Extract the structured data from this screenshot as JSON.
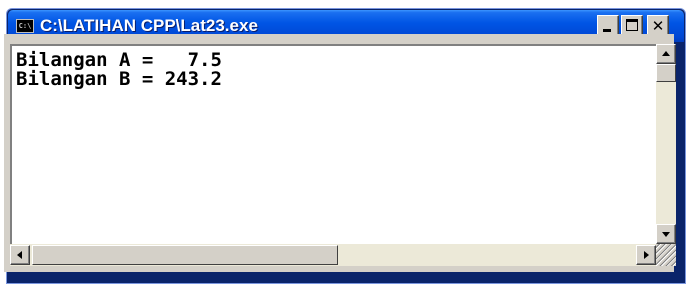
{
  "window": {
    "title": "C:\\LATIHAN CPP\\Lat23.exe",
    "icon": "console-icon",
    "icon_text": "C:\\",
    "controls": {
      "minimize": "minimize-icon",
      "maximize": "maximize-icon",
      "close": "✕"
    }
  },
  "console": {
    "lines": [
      "Bilangan A =   7.5",
      "Bilangan B = 243.2"
    ]
  },
  "colors": {
    "titlebar": "#0055e5",
    "console_bg": "#ffffff",
    "console_text": "#000000",
    "frame": "#d4d0c8"
  }
}
